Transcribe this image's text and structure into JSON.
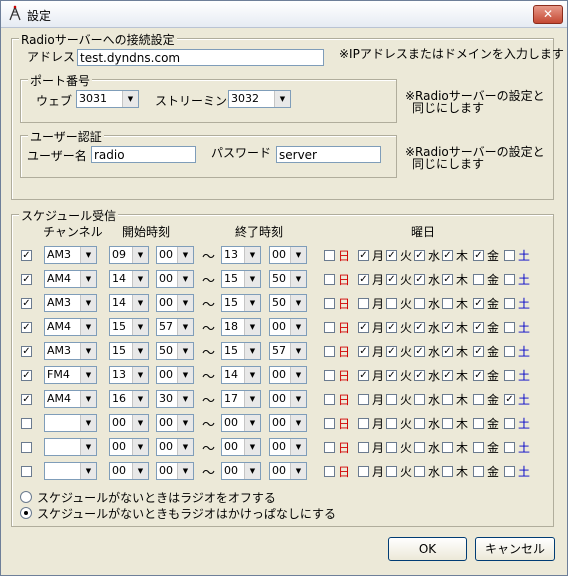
{
  "window": {
    "title": "設定",
    "close_glyph": "✕"
  },
  "server": {
    "group_label": "Radioサーバーへの接続設定",
    "address_label": "アドレス",
    "address_value": "test.dyndns.com",
    "address_note": "※IPアドレスまたはドメインを入力します"
  },
  "port": {
    "group_label": "ポート番号",
    "web_label": "ウェブ",
    "web_value": "3031",
    "streaming_label": "ストリーミング",
    "streaming_value": "3032",
    "note_line1": "※Radioサーバーの設定と",
    "note_line2": "同じにします"
  },
  "auth": {
    "group_label": "ユーザー認証",
    "user_label": "ユーザー名",
    "user_value": "radio",
    "password_label": "パスワード",
    "password_value": "server",
    "note_line1": "※Radioサーバーの設定と",
    "note_line2": "同じにします"
  },
  "schedule": {
    "group_label": "スケジュール受信",
    "col_channel": "チャンネル",
    "col_start": "開始時刻",
    "col_end": "終了時刻",
    "col_days": "曜日",
    "tilde": "〜",
    "day_names": [
      "日",
      "月",
      "火",
      "水",
      "木",
      "金",
      "土"
    ],
    "rows": [
      {
        "enabled": true,
        "channel": "AM3",
        "start_h": "09",
        "start_m": "00",
        "end_h": "13",
        "end_m": "00",
        "days": [
          false,
          true,
          true,
          true,
          true,
          true,
          false
        ]
      },
      {
        "enabled": true,
        "channel": "AM4",
        "start_h": "14",
        "start_m": "00",
        "end_h": "15",
        "end_m": "50",
        "days": [
          false,
          true,
          true,
          true,
          true,
          false,
          false
        ]
      },
      {
        "enabled": true,
        "channel": "AM3",
        "start_h": "14",
        "start_m": "00",
        "end_h": "15",
        "end_m": "50",
        "days": [
          false,
          false,
          false,
          false,
          false,
          true,
          false
        ]
      },
      {
        "enabled": true,
        "channel": "AM4",
        "start_h": "15",
        "start_m": "57",
        "end_h": "18",
        "end_m": "00",
        "days": [
          false,
          true,
          true,
          true,
          true,
          true,
          false
        ]
      },
      {
        "enabled": true,
        "channel": "AM3",
        "start_h": "15",
        "start_m": "50",
        "end_h": "15",
        "end_m": "57",
        "days": [
          false,
          true,
          true,
          true,
          true,
          true,
          false
        ]
      },
      {
        "enabled": true,
        "channel": "FM4",
        "start_h": "13",
        "start_m": "00",
        "end_h": "14",
        "end_m": "00",
        "days": [
          false,
          true,
          true,
          true,
          true,
          true,
          false
        ]
      },
      {
        "enabled": true,
        "channel": "AM4",
        "start_h": "16",
        "start_m": "30",
        "end_h": "17",
        "end_m": "00",
        "days": [
          false,
          false,
          false,
          false,
          false,
          false,
          true
        ]
      },
      {
        "enabled": false,
        "channel": "",
        "start_h": "00",
        "start_m": "00",
        "end_h": "00",
        "end_m": "00",
        "days": [
          false,
          false,
          false,
          false,
          false,
          false,
          false
        ]
      },
      {
        "enabled": false,
        "channel": "",
        "start_h": "00",
        "start_m": "00",
        "end_h": "00",
        "end_m": "00",
        "days": [
          false,
          false,
          false,
          false,
          false,
          false,
          false
        ]
      },
      {
        "enabled": false,
        "channel": "",
        "start_h": "00",
        "start_m": "00",
        "end_h": "00",
        "end_m": "00",
        "days": [
          false,
          false,
          false,
          false,
          false,
          false,
          false
        ]
      }
    ],
    "radio_off_label": "スケジュールがないときはラジオをオフする",
    "radio_keep_label": "スケジュールがないときもラジオはかけっぱなしにする",
    "radio_selected": "keep"
  },
  "buttons": {
    "ok": "OK",
    "cancel": "キャンセル"
  },
  "colors": {
    "sunday": "#d00000",
    "saturday": "#0000c8"
  }
}
